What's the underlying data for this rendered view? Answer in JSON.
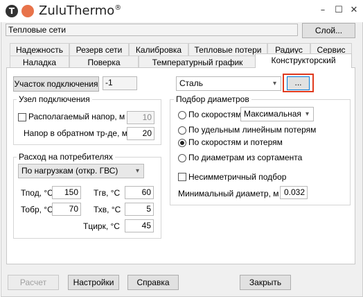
{
  "window": {
    "app_title": "ZuluThermo",
    "trademark": "®",
    "logo_letter": "T",
    "minimize_icon": "–",
    "maximize_icon": "☐",
    "close_icon": "✕"
  },
  "layer": {
    "value": "Тепловые сети",
    "button": "Слой..."
  },
  "tabs_row1": [
    "Надежность",
    "Резерв сети",
    "Калибровка",
    "Тепловые потери",
    "Радиус",
    "Сервис"
  ],
  "tabs_row2": [
    "Наладка",
    "Поверка",
    "Температурный график",
    "Конструкторский"
  ],
  "active_tab": "Конструкторский",
  "connection": {
    "button": "Участок подключения",
    "value": "-1"
  },
  "node_group": {
    "title": "Узел подключения",
    "available_head_label": "Располагаемый напор, м",
    "available_head_value": "10",
    "available_head_checked": false,
    "return_pressure_label": "Напор в обратном тр-де, м",
    "return_pressure_value": "20"
  },
  "consumer_group": {
    "title": "Расход на потребителях",
    "mode": "По нагрузкам (откр. ГВС)",
    "t_supply_label": "Тпод, °С",
    "t_supply": "150",
    "t_hot_label": "Тгв, °С",
    "t_hot": "60",
    "t_return_label": "Тобр, °С",
    "t_return": "70",
    "t_cold_label": "Тхв, °С",
    "t_cold": "5",
    "t_circ_label": "Тцирк, °С",
    "t_circ": "45"
  },
  "material": {
    "value": "Сталь",
    "browse_button": "..."
  },
  "diameter_group": {
    "title": "Подбор диаметров",
    "options": [
      "По скоростям",
      "По удельным линейным потерям",
      "По скоростям и потерям",
      "По диаметрам из сортамента"
    ],
    "selected_index": 2,
    "velocity_mode": "Максимальная",
    "asymmetric_label": "Несимметричный подбор",
    "asymmetric_checked": false,
    "min_diameter_label": "Минимальный диаметр, м",
    "min_diameter_value": "0.032"
  },
  "buttons": {
    "calculate": "Расчет",
    "settings": "Настройки",
    "help": "Справка",
    "close": "Закрыть"
  },
  "colors": {
    "highlight": "#e03a1e",
    "accent": "#e8734a"
  }
}
